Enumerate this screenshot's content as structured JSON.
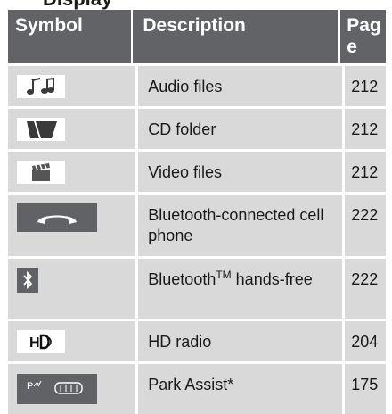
{
  "title_fragment": "Display",
  "header": {
    "symbol": "Symbol",
    "description": "Description",
    "page": "Page"
  },
  "rows": [
    {
      "icon": "music-notes-icon",
      "description": "Audio files",
      "page": "212"
    },
    {
      "icon": "cd-folder-icon",
      "description": "CD folder",
      "page": "212"
    },
    {
      "icon": "clapperboard-icon",
      "description": "Video files",
      "page": "212"
    },
    {
      "icon": "phone-handset-icon",
      "description": "Bluetooth-connected cell phone",
      "page": "222"
    },
    {
      "icon": "bluetooth-icon",
      "description_main": "Bluetooth",
      "description_sup": "TM",
      "description_rest": " hands-free",
      "page": "222"
    },
    {
      "icon": "hd-radio-icon",
      "description": "HD radio",
      "page": "204"
    },
    {
      "icon": "park-assist-icon",
      "description": "Park Assist*",
      "page": "175"
    }
  ]
}
